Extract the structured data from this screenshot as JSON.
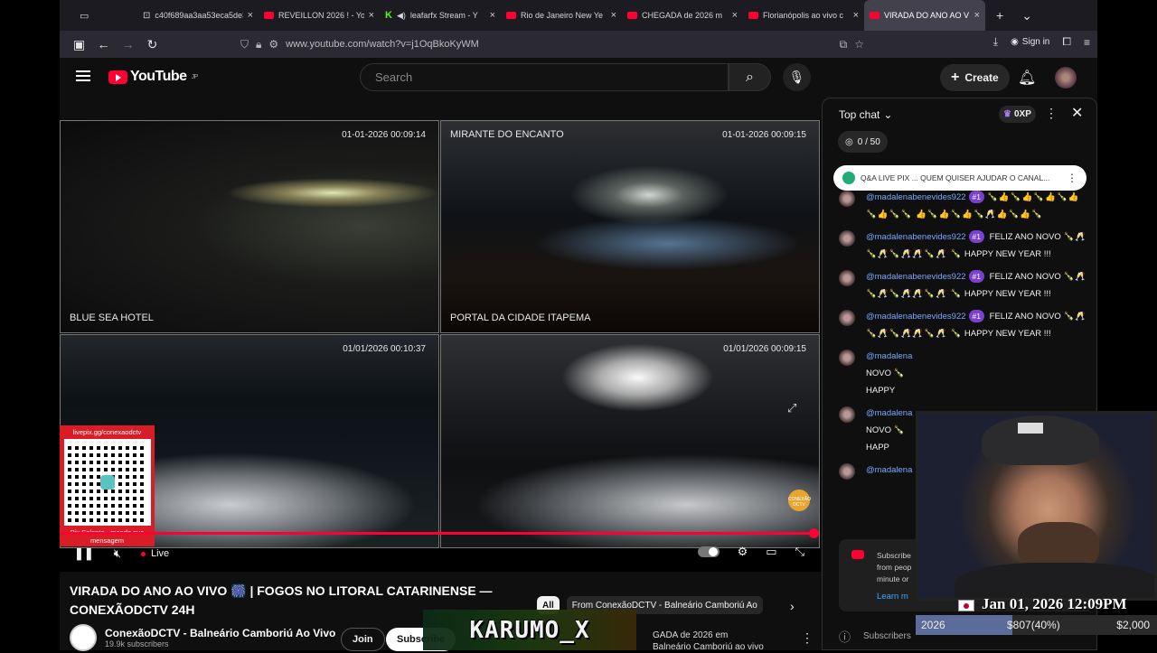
{
  "tabs": [
    {
      "title": "c40f689aa3aa53eca5de3"
    },
    {
      "title": "REVEILLON 2026 ! - Yo"
    },
    {
      "title": "leafarfx Stream - Y"
    },
    {
      "title": "Rio de Janeiro New Ye"
    },
    {
      "title": "CHEGADA de 2026 m"
    },
    {
      "title": "Florianópolis ao vivo c"
    },
    {
      "title": "VIRADA DO ANO AO V"
    }
  ],
  "browser": {
    "url": "www.youtube.com/watch?v=j1OqBkoKyWM",
    "sign_in": "Sign in"
  },
  "yt": {
    "logo": "YouTube",
    "region": "JP",
    "search_placeholder": "Search",
    "create": "Create"
  },
  "player": {
    "cams": [
      {
        "timestamp": "01-01-2026 00:09:14",
        "name": "BLUE SEA HOTEL"
      },
      {
        "timestamp": "01-01-2026 00:09:15",
        "name": "MIRANTE DO ENCANTO",
        "bottom_name": "PORTAL DA CIDADE ITAPEMA"
      },
      {
        "timestamp": "01/01/2026 00:10:37",
        "name": ""
      },
      {
        "timestamp": "01/01/2026 00:09:15",
        "name": ""
      }
    ],
    "qr_top": "livepix.gg/conexaodctv",
    "qr_bottom": "Pix Solente - mande sua mensagem",
    "live_label": "Live",
    "progress": 1.0,
    "channel_bug": "CONEXÃO DCTV"
  },
  "video": {
    "title": "VIRADA DO ANO AO VIVO 🎆 | FOGOS NO LITORAL CATARINENSE — CONEXÃODCTV 24H",
    "channel": "ConexãoDCTV - Balneário Camboriú Ao Vivo",
    "subscribers": "19.9k subscribers",
    "join": "Join",
    "subscribe": "Subscribe"
  },
  "chips": {
    "all": "All",
    "second": "From ConexãoDCTV - Balneário Camboriú Ao"
  },
  "related": {
    "line1": "GADA de 2026 em",
    "line2": "Balneário Camboriú ao vivo"
  },
  "overlay_name": "KARUMO_X",
  "chat": {
    "mode": "Top chat",
    "xp": "0XP",
    "goal": "0 / 50",
    "pinned": "Q&A  LIVE PIX ... QUEM QUISER AJUDAR O CANAL...",
    "messages": [
      {
        "author": "@madalenabenevides922",
        "badge": "#1",
        "text": "",
        "emoji": "🍾👍🍾👍🍾👍🍾👍🍾👍🍾🍾 👍🍾👍🍾👍🍾🥂👍🍾👍🍾"
      },
      {
        "author": "@madalenabenevides922",
        "badge": "#1",
        "text": "FELIZ ANO NOVO",
        "emoji": "🍾🥂🍾🥂🍾🥂🥂🍾🥂 🍾",
        "tail": "HAPPY NEW YEAR !!!"
      },
      {
        "author": "@madalenabenevides922",
        "badge": "#1",
        "text": "FELIZ ANO NOVO",
        "emoji": "🍾🥂🍾🥂🍾🥂🥂🍾🥂 🍾",
        "tail": "HAPPY NEW YEAR !!!"
      },
      {
        "author": "@madalenabenevides922",
        "badge": "#1",
        "text": "FELIZ ANO NOVO",
        "emoji": "🍾🥂🍾🥂🍾🥂🥂🍾🥂 🍾",
        "tail": "HAPPY NEW YEAR !!!"
      },
      {
        "author": "@madalena",
        "badge": "",
        "text": "NOVO",
        "emoji": "🍾",
        "tail": "HAPPY"
      },
      {
        "author": "@madalena",
        "badge": "",
        "text": "NOVO",
        "emoji": "🍾",
        "tail": "HAPP"
      },
      {
        "author": "@madalena",
        "badge": "",
        "text": "",
        "emoji": "",
        "tail": ""
      }
    ],
    "subscribe_card": {
      "line1": "Subscribe",
      "line2": "from peop",
      "line3": "minute or",
      "learn": "Learn m"
    },
    "input_placeholder": "Subscribers"
  },
  "overlay": {
    "date": "Jan 01, 2026 12:09PM",
    "year": "2026",
    "amount": "$807(40%)",
    "goal": "$2,000",
    "progress_pct": 40
  }
}
